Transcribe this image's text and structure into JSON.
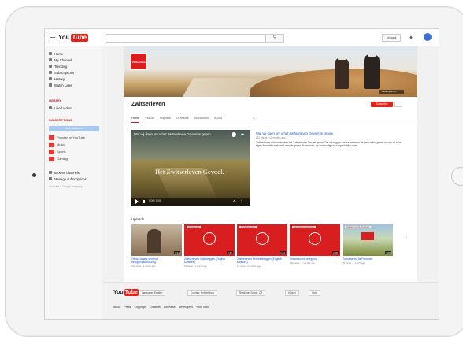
{
  "header": {
    "logo_you": "You",
    "logo_tube": "Tube",
    "search_placeholder": "",
    "upload_label": "Upload"
  },
  "sidebar": {
    "items": [
      {
        "label": "Home"
      },
      {
        "label": "My Channel"
      },
      {
        "label": "Trending"
      },
      {
        "label": "Subscriptions"
      },
      {
        "label": "History"
      },
      {
        "label": "Watch Later"
      }
    ],
    "section_library": "LIBRARY",
    "liked_videos": "Liked videos",
    "section_subscriptions": "SUBSCRIPTIONS",
    "add_channels": "Add channels",
    "channels": [
      {
        "label": "Popular on YouTube"
      },
      {
        "label": "Music"
      },
      {
        "label": "Sports"
      },
      {
        "label": "Gaming"
      }
    ],
    "browse_channels": "Browse channels",
    "manage_subscriptions": "Manage subscriptions",
    "footer_text": "YouTube a Google company"
  },
  "channel": {
    "name": "Zwitserleven",
    "logo_text": "Zwitserleven",
    "banner_link": "zwitserleven.nl",
    "subscribe_label": "Subscribe",
    "tabs": [
      "Home",
      "Videos",
      "Playlists",
      "Channels",
      "Discussion",
      "About"
    ]
  },
  "featured": {
    "title": "Wat wij doen om u het Zwitserleven Gevoel te geven",
    "overlay_text": "Het Zwitserleven Gevoel.",
    "time": "0:00 / 1:05",
    "info_title": "Wat wij doen om u het Zwitserleven Gevoel te geven",
    "info_meta": "831 views · 11 months ago",
    "info_desc": "Zwitserleven wil haar klanten het Zwitserleven Gevoel geven. Dat wil zeggen dat we iedereen de kans willen geven om zijn of haar eigen financiële toekomst vorm te geven. Nu en later, op eenvoudige en toegankelijke wijze."
  },
  "uploads": {
    "title": "Uploads",
    "items": [
      {
        "title": "Olivia Dagers sentimat beleggingsoplossing",
        "meta": "612 views · 1 month ago",
        "duration": "1:21",
        "label": ""
      },
      {
        "title": "Zwitserleven Vrijbeleggen (English subtitles)",
        "meta": "19 views · 1 month ago",
        "duration": "2:45",
        "label": "Vrijbeleggen"
      },
      {
        "title": "Zwitserleven Profielbeleggen (English subtitles)",
        "meta": "11 views · 2 months ago",
        "duration": "2:43",
        "label": "Profielbeleggen"
      },
      {
        "title": "Verantwoord beleggen",
        "meta": "156 views · 2 months ago",
        "duration": "2:05",
        "label": "Verantwoord beleggen"
      },
      {
        "title": "Zwitserleven NuPensioen",
        "meta": "85 views · 1 month ago",
        "duration": "3:05",
        "label": "Zwitserleven NuPensioen"
      }
    ]
  },
  "footer": {
    "logo_you": "You",
    "logo_tube": "Tube",
    "language": "Language: English",
    "country": "Country: Netherlands",
    "restricted": "Restricted Mode: Off",
    "history": "History",
    "help": "Help",
    "links": [
      "About",
      "Press",
      "Copyright",
      "Creators",
      "Advertise",
      "Developers",
      "+YouTube"
    ]
  }
}
